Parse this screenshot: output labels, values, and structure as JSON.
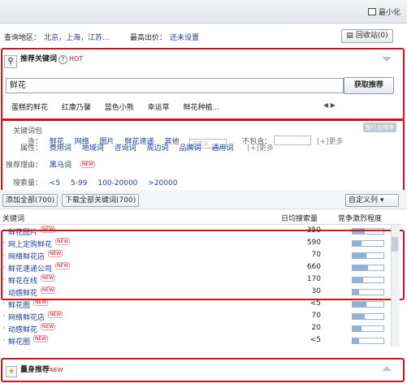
{
  "window": {
    "minimize_label": "最小化"
  },
  "top": {
    "region_label": "查询地区：",
    "region_value": "北京，上海，江苏...",
    "bid_label": "最高出价：",
    "bid_value": "还未设置",
    "recycle_label": "回收站",
    "recycle_count": "(0)"
  },
  "hot": {
    "title": "推荐关键词",
    "hot_badge": "HOT",
    "input_value": "鲜花",
    "get_button": "获取推荐",
    "suggestions": [
      "蛋糕的鲜花",
      "红康乃馨",
      "蓝色小熊",
      "幸运草",
      "鲜花种植..."
    ]
  },
  "filters": {
    "include_label": "关键词包含：",
    "include_items": [
      "鲜花",
      "网络",
      "图片",
      "鲜花速递",
      "其他"
    ],
    "include_placeholder": "自定义",
    "exclude_label": "不包含：",
    "more": "[+]更多",
    "attr_label": "属性：",
    "attr_items": [
      "费用词",
      "地域词",
      "咨询词",
      "周边词",
      "品牌词",
      "通用词"
    ],
    "reason_label": "推荐理由：",
    "reason_item": "黑马词",
    "volume_label": "搜索量：",
    "volume_items": [
      "<5",
      "5-99",
      "100-20000",
      ">20000"
    ],
    "sort_pill": "按行业排序",
    "new_badge": "NEW"
  },
  "actions": {
    "add_all": "添加全部(700)",
    "download_all": "下载全部关键词(700)",
    "custom_column": "自定义列"
  },
  "table": {
    "col_keyword": "关键词",
    "col_volume": "日均搜索量",
    "col_competition": "竞争激烈程度",
    "rows": [
      {
        "keyword": "鲜花图片",
        "volume": "350",
        "competition": 0.4,
        "new": true
      },
      {
        "keyword": "网上定购鲜花",
        "volume": "590",
        "competition": 0.3,
        "new": true
      },
      {
        "keyword": "网络鲜花店",
        "volume": "70",
        "competition": 0.45,
        "new": true
      },
      {
        "keyword": "鲜花速递公司",
        "volume": "660",
        "competition": 0.5,
        "new": true
      },
      {
        "keyword": "鲜花在线",
        "volume": "170",
        "competition": 0.35,
        "new": true
      },
      {
        "keyword": "动感鲜花",
        "volume": "30",
        "competition": 0.2,
        "new": true
      },
      {
        "keyword": "鲜花图",
        "volume": "<5",
        "competition": 0.45,
        "new": true
      },
      {
        "keyword": "网络鲜花店",
        "volume": "70",
        "competition": 0.4,
        "new": true
      },
      {
        "keyword": "动感鲜花",
        "volume": "20",
        "competition": 0.3,
        "new": true
      },
      {
        "keyword": "鲜花图",
        "volume": "<5",
        "competition": 0.2,
        "new": true
      }
    ]
  },
  "custom": {
    "title": "量身推荐",
    "new_badge": "NEW"
  }
}
